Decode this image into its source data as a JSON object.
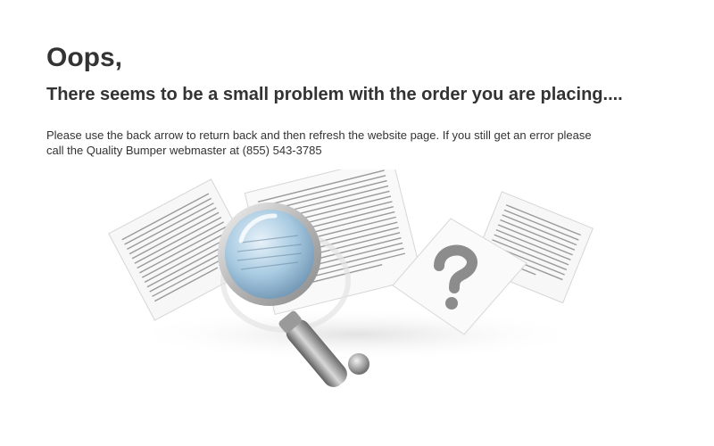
{
  "error_page": {
    "heading": "Oops,",
    "subheading": "There seems to be a small problem with the order you are placing....",
    "message_line1": "Please use the back arrow to return back and then refresh the website page.  If you still get an error please",
    "message_line2": "call the Quality Bumper webmaster at (855) 543-3785"
  },
  "illustration": {
    "icons": [
      "document-icon",
      "magnifying-glass-icon",
      "question-mark-icon"
    ],
    "colors": {
      "paper": "#f7f7f7",
      "paper_edge": "#d6d6d6",
      "text_lines": "#9a9a9a",
      "lens": "#9fc3dc",
      "handle": "#7d7d7d",
      "question_mark": "#8c8c8c"
    }
  }
}
